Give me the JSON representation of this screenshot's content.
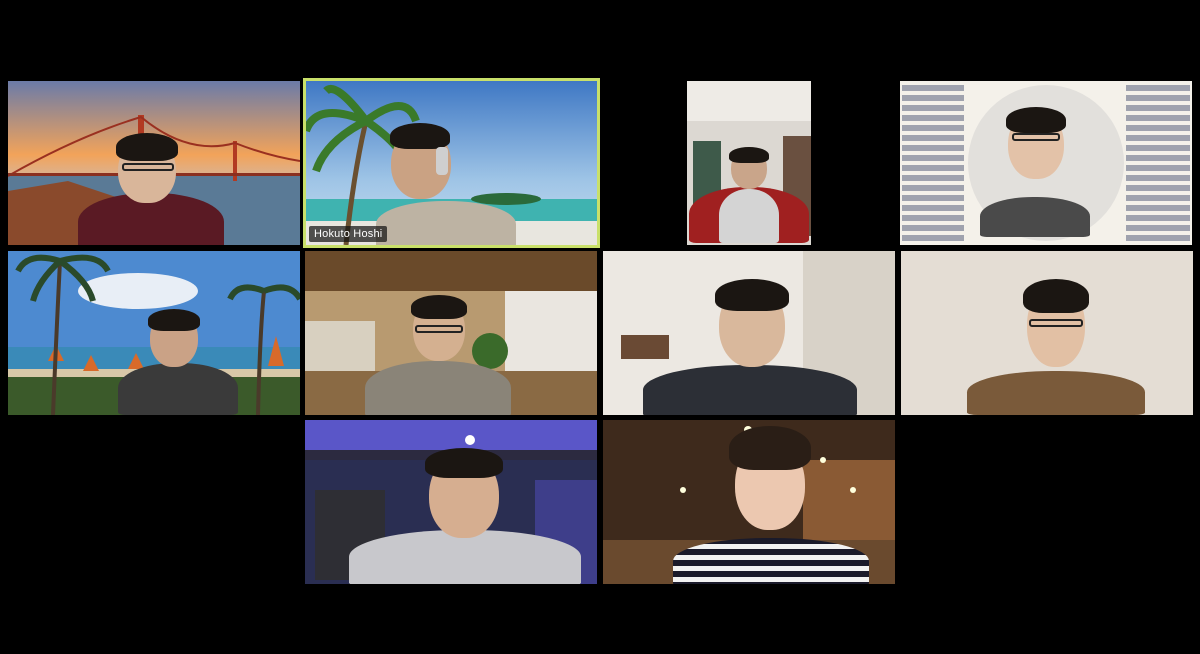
{
  "meeting": {
    "layout": "gallery",
    "participants": [
      {
        "id": "p1",
        "name": "",
        "background": "golden-gate-bridge-sunset"
      },
      {
        "id": "p2",
        "name": "Hokuto Hoshi",
        "background": "tropical-beach-palm",
        "active_speaker": true
      },
      {
        "id": "p3",
        "name": "",
        "background": "room-camera"
      },
      {
        "id": "p4",
        "name": "",
        "background": "circular-crop-collage"
      },
      {
        "id": "p5",
        "name": "",
        "background": "hawaii-resort-beach"
      },
      {
        "id": "p6",
        "name": "",
        "background": "office-lounge"
      },
      {
        "id": "p7",
        "name": "",
        "background": "plain-room"
      },
      {
        "id": "p8",
        "name": "",
        "background": "plain-wall"
      },
      {
        "id": "p9",
        "name": "",
        "background": "party-venue-blue-lights"
      },
      {
        "id": "p10",
        "name": "",
        "background": "restaurant-warm-lights"
      }
    ]
  },
  "colors": {
    "active_border": "#c9e06a",
    "background": "#000000"
  }
}
